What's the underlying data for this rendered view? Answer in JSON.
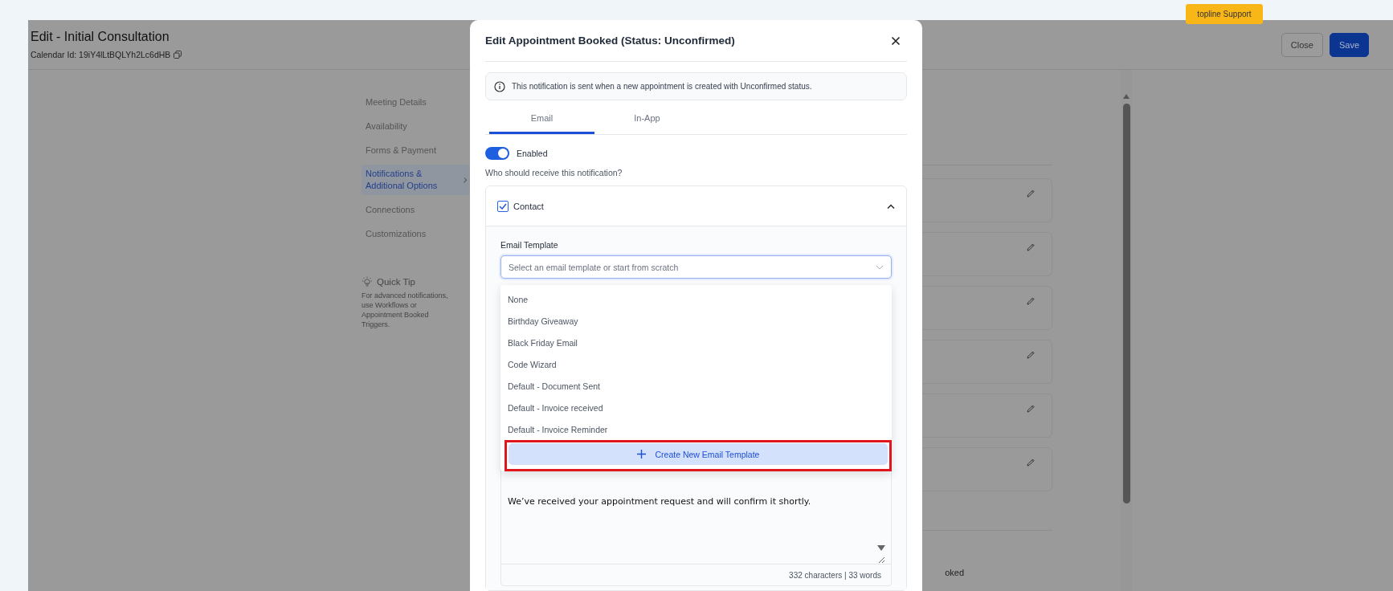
{
  "top_bar": {
    "support_badge": "topline Support"
  },
  "page": {
    "title": "Edit - Initial Consultation",
    "calendar_id": "Calendar Id: 19iY4lLtBQLYh2Lc6dHB",
    "buttons": [
      {
        "label": "Close",
        "kind": "secondary"
      },
      {
        "label": "Save",
        "kind": "primary"
      }
    ]
  },
  "sidebar": {
    "items": [
      {
        "label": "Meeting Details",
        "selected": false
      },
      {
        "label": "Availability",
        "selected": false
      },
      {
        "label": "Forms & Payment",
        "selected": false
      },
      {
        "label": "Notifications & Additional Options",
        "selected": true
      },
      {
        "label": "Connections",
        "selected": false
      },
      {
        "label": "Customizations",
        "selected": false
      }
    ],
    "quick_tip": {
      "title": "Quick Tip",
      "text": "For advanced notifications, use Workflows or Appointment Booked Triggers."
    }
  },
  "background_label": "oked",
  "modal": {
    "title": "Edit Appointment Booked (Status: Unconfirmed)",
    "info": "This notification is sent when a new appointment is created with Unconfirmed status.",
    "tabs": [
      {
        "label": "Email",
        "selected": true
      },
      {
        "label": "In-App",
        "selected": false
      }
    ],
    "enabled": {
      "label": "Enabled",
      "on": true
    },
    "recipients_label": "Who should receive this notification?",
    "recipient": {
      "label": "Contact",
      "checked": true,
      "expanded": true
    },
    "template_label": "Email Template",
    "template_select": {
      "placeholder": "Select an email template or start from scratch"
    },
    "template_options": [
      "None",
      "Birthday Giveaway",
      "Black Friday Email",
      "Code Wizard",
      "Default - Document Sent",
      "Default - Invoice received",
      "Default - Invoice Reminder"
    ],
    "create_button": {
      "label": "Create New Email Template",
      "highlighted": true
    },
    "message": "We’ve received your appointment request and will confirm it shortly.",
    "counter": "332 characters | 33 words"
  }
}
